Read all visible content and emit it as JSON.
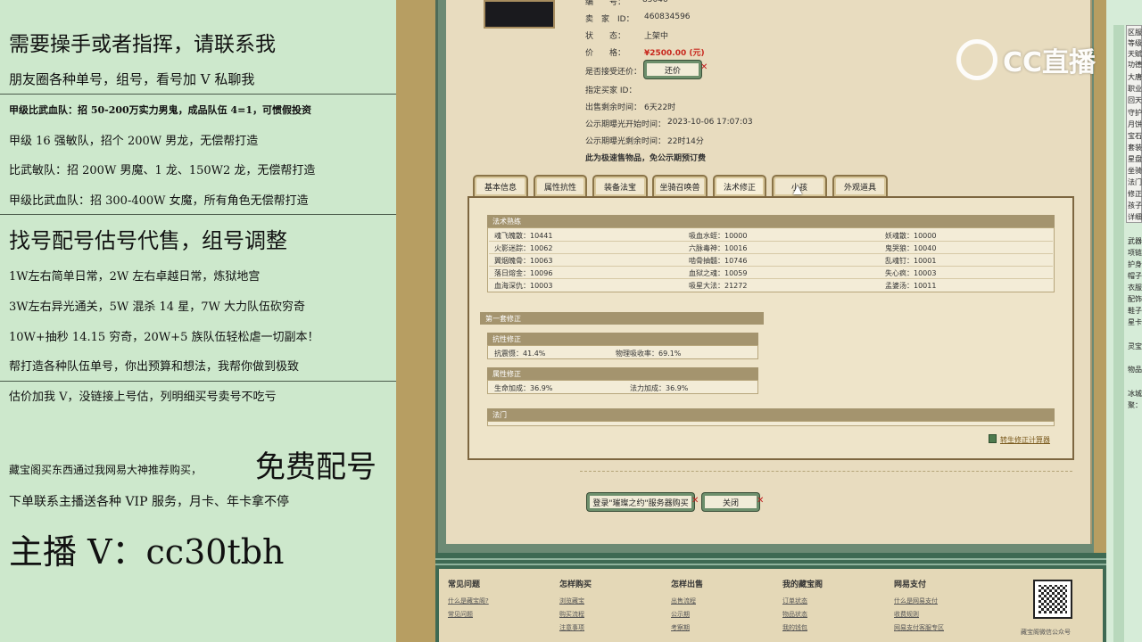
{
  "left_overlay": {
    "lines": [
      "需要操手或者指挥，请联系我",
      "朋友圈各种单号，组号，看号加 V 私聊我",
      "甲级比武血队：招 50-200万实力男鬼，成品队伍 4=1，可惯假投资",
      "甲级 16 强敏队，招个 200W 男龙，无偿帮打造",
      "比武敏队：招 200W 男魔、1 龙、150W2 龙，无偿帮打造",
      "甲级比武血队：招 300-400W 女魔，所有角色无偿帮打造",
      "找号配号估号代售，组号调整",
      "1W左右简单日常，2W 左右卓越日常，炼狱地宫",
      "3W左右异光通关，5W 混杀 14 星，7W 大力队伍砍穷奇",
      "10W+抽秒 14.15 穷奇，20W+5 族队伍轻松虐一切副本！",
      "帮打造各种队伍单号，你出预算和想法，我帮你做到极致",
      "估价加我 V，没链接上号估，列明细买号卖号不吃亏",
      "藏宝阁买东西通过我网易大神推荐购买，",
      "免费配号",
      "下单联系主播送各种 VIP 服务，月卡、年卡拿不停",
      "主播 V：cc30tbh"
    ]
  },
  "item_info": {
    "rows": [
      {
        "label": "编　　号：",
        "value": "85046"
      },
      {
        "label": "卖　家　ID：",
        "value": "460834596"
      },
      {
        "label": "状　　态：",
        "value": "上架中"
      },
      {
        "label": "价　　格：",
        "value": "¥2500.00 (元)"
      },
      {
        "label": "是否接受还价：",
        "value": ""
      },
      {
        "label": "指定买家 ID：",
        "value": ""
      },
      {
        "label": "出售剩余时间：",
        "value": "6天22时"
      },
      {
        "label": "公示期曝光开始时间：",
        "value": "2023-10-06 17:07:03"
      },
      {
        "label": "公示期曝光剩余时间：",
        "value": "22时14分"
      },
      {
        "label": "此为极速售物品，免公示期预订费",
        "value": ""
      }
    ],
    "counter_offer_button": "还价"
  },
  "tabs": [
    "基本信息",
    "属性抗性",
    "装备法宝",
    "坐骑召唤兽",
    "法术修正",
    "小孩",
    "外观道具"
  ],
  "active_tab": 4,
  "spell_section": {
    "title": "法术熟练",
    "cells": [
      [
        "魂飞魄散：10441",
        "吸血水蛭：10000",
        "妖魂散：10000"
      ],
      [
        "火影迷踪：10062",
        "六脉毒神：10016",
        "鬼哭狼：10040"
      ],
      [
        "翼烟魄骨：10063",
        "啮骨抽髓：10746",
        "乱魂钉：10001"
      ],
      [
        "落日熔金：10096",
        "血狱之魂：10059",
        "失心疯：10003"
      ],
      [
        "血海深仇：10003",
        "吸星大法：21272",
        "孟婆汤：10011"
      ]
    ]
  },
  "correction": {
    "title": "第一套修正",
    "resist": {
      "title": "抗性修正",
      "a": "抗震慑：41.4%",
      "b": "物理吸收率：69.1%"
    },
    "attr": {
      "title": "属性修正",
      "a": "生命加成：36.9%",
      "b": "法力加成：36.9%"
    },
    "gate": {
      "title": "法门"
    }
  },
  "calc_link": "转生修正计算器",
  "bottom_buttons": {
    "buy": "登录\"璀璨之约\"服务器购买",
    "close": "关闭"
  },
  "watermark": "CC直播",
  "footer": {
    "cols": [
      {
        "title": "常见问题",
        "links": [
          "什么是藏宝阁?",
          "常见问题"
        ]
      },
      {
        "title": "怎样购买",
        "links": [
          "浏览藏宝",
          "购买流程",
          "注意事项"
        ]
      },
      {
        "title": "怎样出售",
        "links": [
          "出售流程",
          "公示期",
          "考察期"
        ]
      },
      {
        "title": "我的藏宝阁",
        "links": [
          "订单状态",
          "物品状态",
          "我的钱包"
        ]
      },
      {
        "title": "网易支付",
        "links": [
          "什么是网易支付",
          "收费规则",
          "网易支付客服专区"
        ]
      }
    ],
    "qr_caption": "藏宝阁微信公众号"
  },
  "right_strip": [
    "区服",
    "等级",
    "天赋",
    "功德",
    "大唐",
    "职业",
    "回天",
    "守护",
    "月饼",
    "宝石",
    "套装",
    "星盘",
    "坐骑",
    "法门",
    "修正",
    "孩子",
    "详细",
    "武器",
    "项链",
    "护身",
    "帽子",
    "衣服",
    "配饰",
    "鞋子",
    "星卡",
    "灵宝",
    "物品",
    "冰城",
    "聚："
  ],
  "colors": {
    "price": "#c8281e",
    "accent_green": "#3e6a53",
    "paper": "#e8dcbf"
  }
}
